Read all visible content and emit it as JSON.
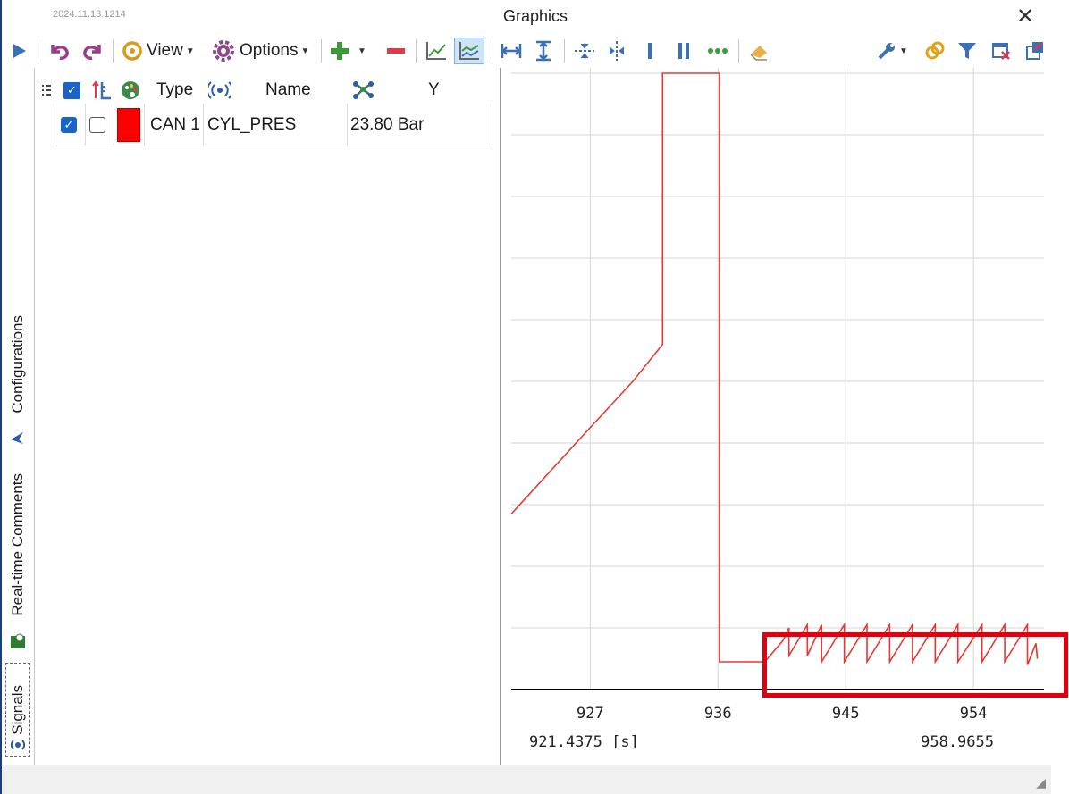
{
  "window": {
    "version": "2024.11.13.1214",
    "title": "Graphics",
    "close_glyph": "✕"
  },
  "toolbar": {
    "view_label": "View",
    "options_label": "Options",
    "icons": [
      "play-icon",
      "undo-icon",
      "redo-icon",
      "view-icon",
      "options-icon",
      "add-icon",
      "remove-icon",
      "line-chart-icon",
      "multi-line-chart-icon",
      "fit-horizontal-icon",
      "fit-vertical-icon",
      "zoom-horizontal-icon",
      "zoom-vertical-icon",
      "cursor-single-icon",
      "cursor-double-icon",
      "cursor-more-icon",
      "eraser-icon",
      "tools-icon",
      "link-icon",
      "filter-icon",
      "close-window-icon",
      "export-icon"
    ]
  },
  "side_tabs": [
    "Configurations",
    "Real-time Comments",
    "Signals"
  ],
  "signals_table": {
    "headers": {
      "type": "Type",
      "name": "Name",
      "y": "Y"
    },
    "rows": [
      {
        "visible": true,
        "locked": false,
        "color": "#ff0000",
        "type": "CAN 1",
        "name": "CYL_PRES",
        "y": "23.80 Bar"
      }
    ]
  },
  "chart_data": {
    "type": "line",
    "x_ticks": [
      "927",
      "936",
      "945",
      "954"
    ],
    "x_start_label": "921.4375 [s]",
    "x_end_label": "958.9655",
    "xlim": [
      921.4375,
      958.9655
    ],
    "ylim": [
      0,
      100
    ],
    "grid": true,
    "series": [
      {
        "color": "#e53935",
        "x": [
          921.44,
          926.0,
          930.0,
          932.1,
          932.1,
          934.2,
          934.2,
          936.0,
          936.1,
          936.1,
          939.3,
          940.6,
          941.0,
          941.0,
          942.3,
          942.3,
          943.3,
          943.3,
          944.9,
          944.9,
          946.5,
          946.5,
          948.1,
          948.1,
          949.7,
          949.7,
          951.3,
          951.3,
          952.9,
          952.9,
          954.6,
          954.6,
          956.2,
          956.2,
          957.8,
          957.8,
          958.4,
          958.5
        ],
        "y": [
          28.5,
          40.0,
          50.0,
          56.0,
          100,
          100,
          100,
          100,
          100,
          4.5,
          4.5,
          8.0,
          10.0,
          5.5,
          10.5,
          5.5,
          10.5,
          4.5,
          10.5,
          4.5,
          10.5,
          4.5,
          10.5,
          4.5,
          10.5,
          4.5,
          10.5,
          4.5,
          10.5,
          4.5,
          10.5,
          4.5,
          10.5,
          4.5,
          10.5,
          4.0,
          7.5,
          5.0
        ]
      }
    ]
  }
}
